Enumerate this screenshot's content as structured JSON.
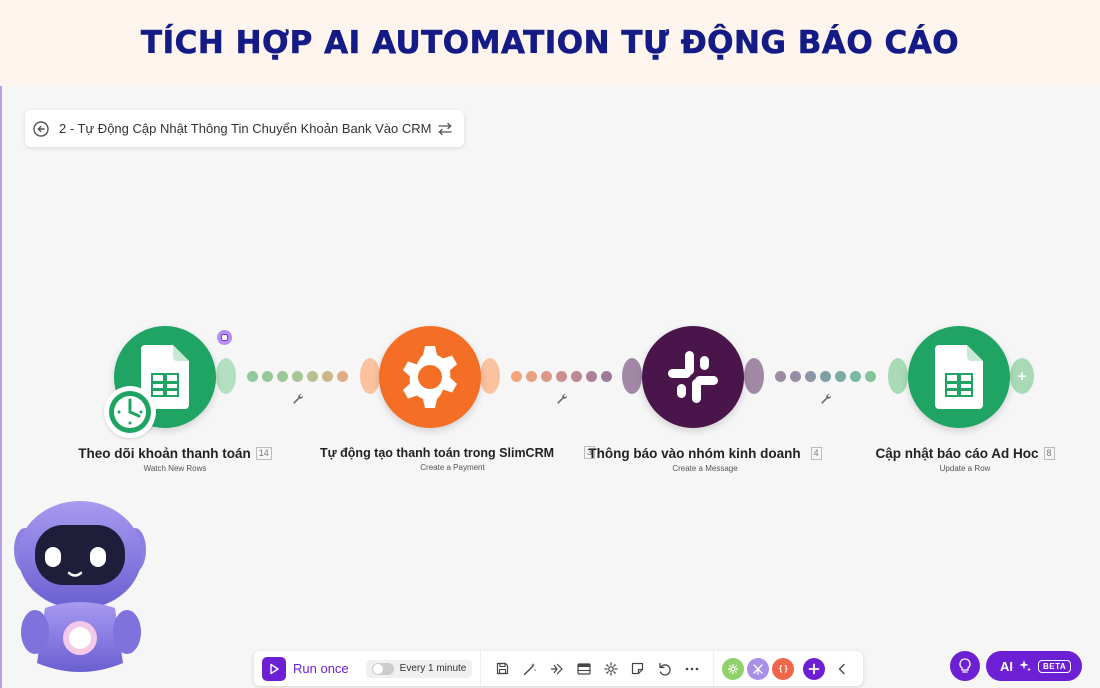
{
  "banner": {
    "title": "TÍCH HỢP AI AUTOMATION TỰ ĐỘNG BÁO CÁO"
  },
  "scenario": {
    "title": "2 - Tự Động Cập Nhật Thông Tin Chuyển Khoản Bank Vào CRM"
  },
  "modules": [
    {
      "name": "Theo dõi khoản thanh toán",
      "number": "14",
      "action": "Watch New Rows",
      "app_icon": "google-sheets-icon",
      "color": "#1fa463"
    },
    {
      "name": "Tự động tạo thanh toán trong SlimCRM",
      "number": "3",
      "action": "Create a Payment",
      "app_icon": "gear-icon",
      "color": "#f46f25"
    },
    {
      "name": "Thông báo vào nhóm kinh doanh",
      "number": "4",
      "action": "Create a Message",
      "app_icon": "slack-icon",
      "color": "#4a154b"
    },
    {
      "name": "Cập nhật báo cáo Ad Hoc",
      "number": "8",
      "action": "Update a Row",
      "app_icon": "google-sheets-icon",
      "color": "#1fa463"
    }
  ],
  "toolbar": {
    "run_label": "Run once",
    "schedule_label": "Every 1 minute",
    "icons": [
      "save-icon",
      "magic-wand-icon",
      "flow-icon",
      "table-icon",
      "settings-icon",
      "note-icon",
      "undo-icon",
      "more-icon"
    ],
    "app_icons": [
      "tools-icon",
      "flow-control-icon",
      "json-icon",
      "add-icon",
      "collapse-icon"
    ]
  },
  "ai": {
    "label": "AI",
    "badge": "BETA"
  },
  "colors": {
    "accent": "#6d1fd4",
    "banner_text": "#141a86",
    "sheets": "#1fa463",
    "crm": "#f46f25",
    "slack": "#4a154b"
  }
}
